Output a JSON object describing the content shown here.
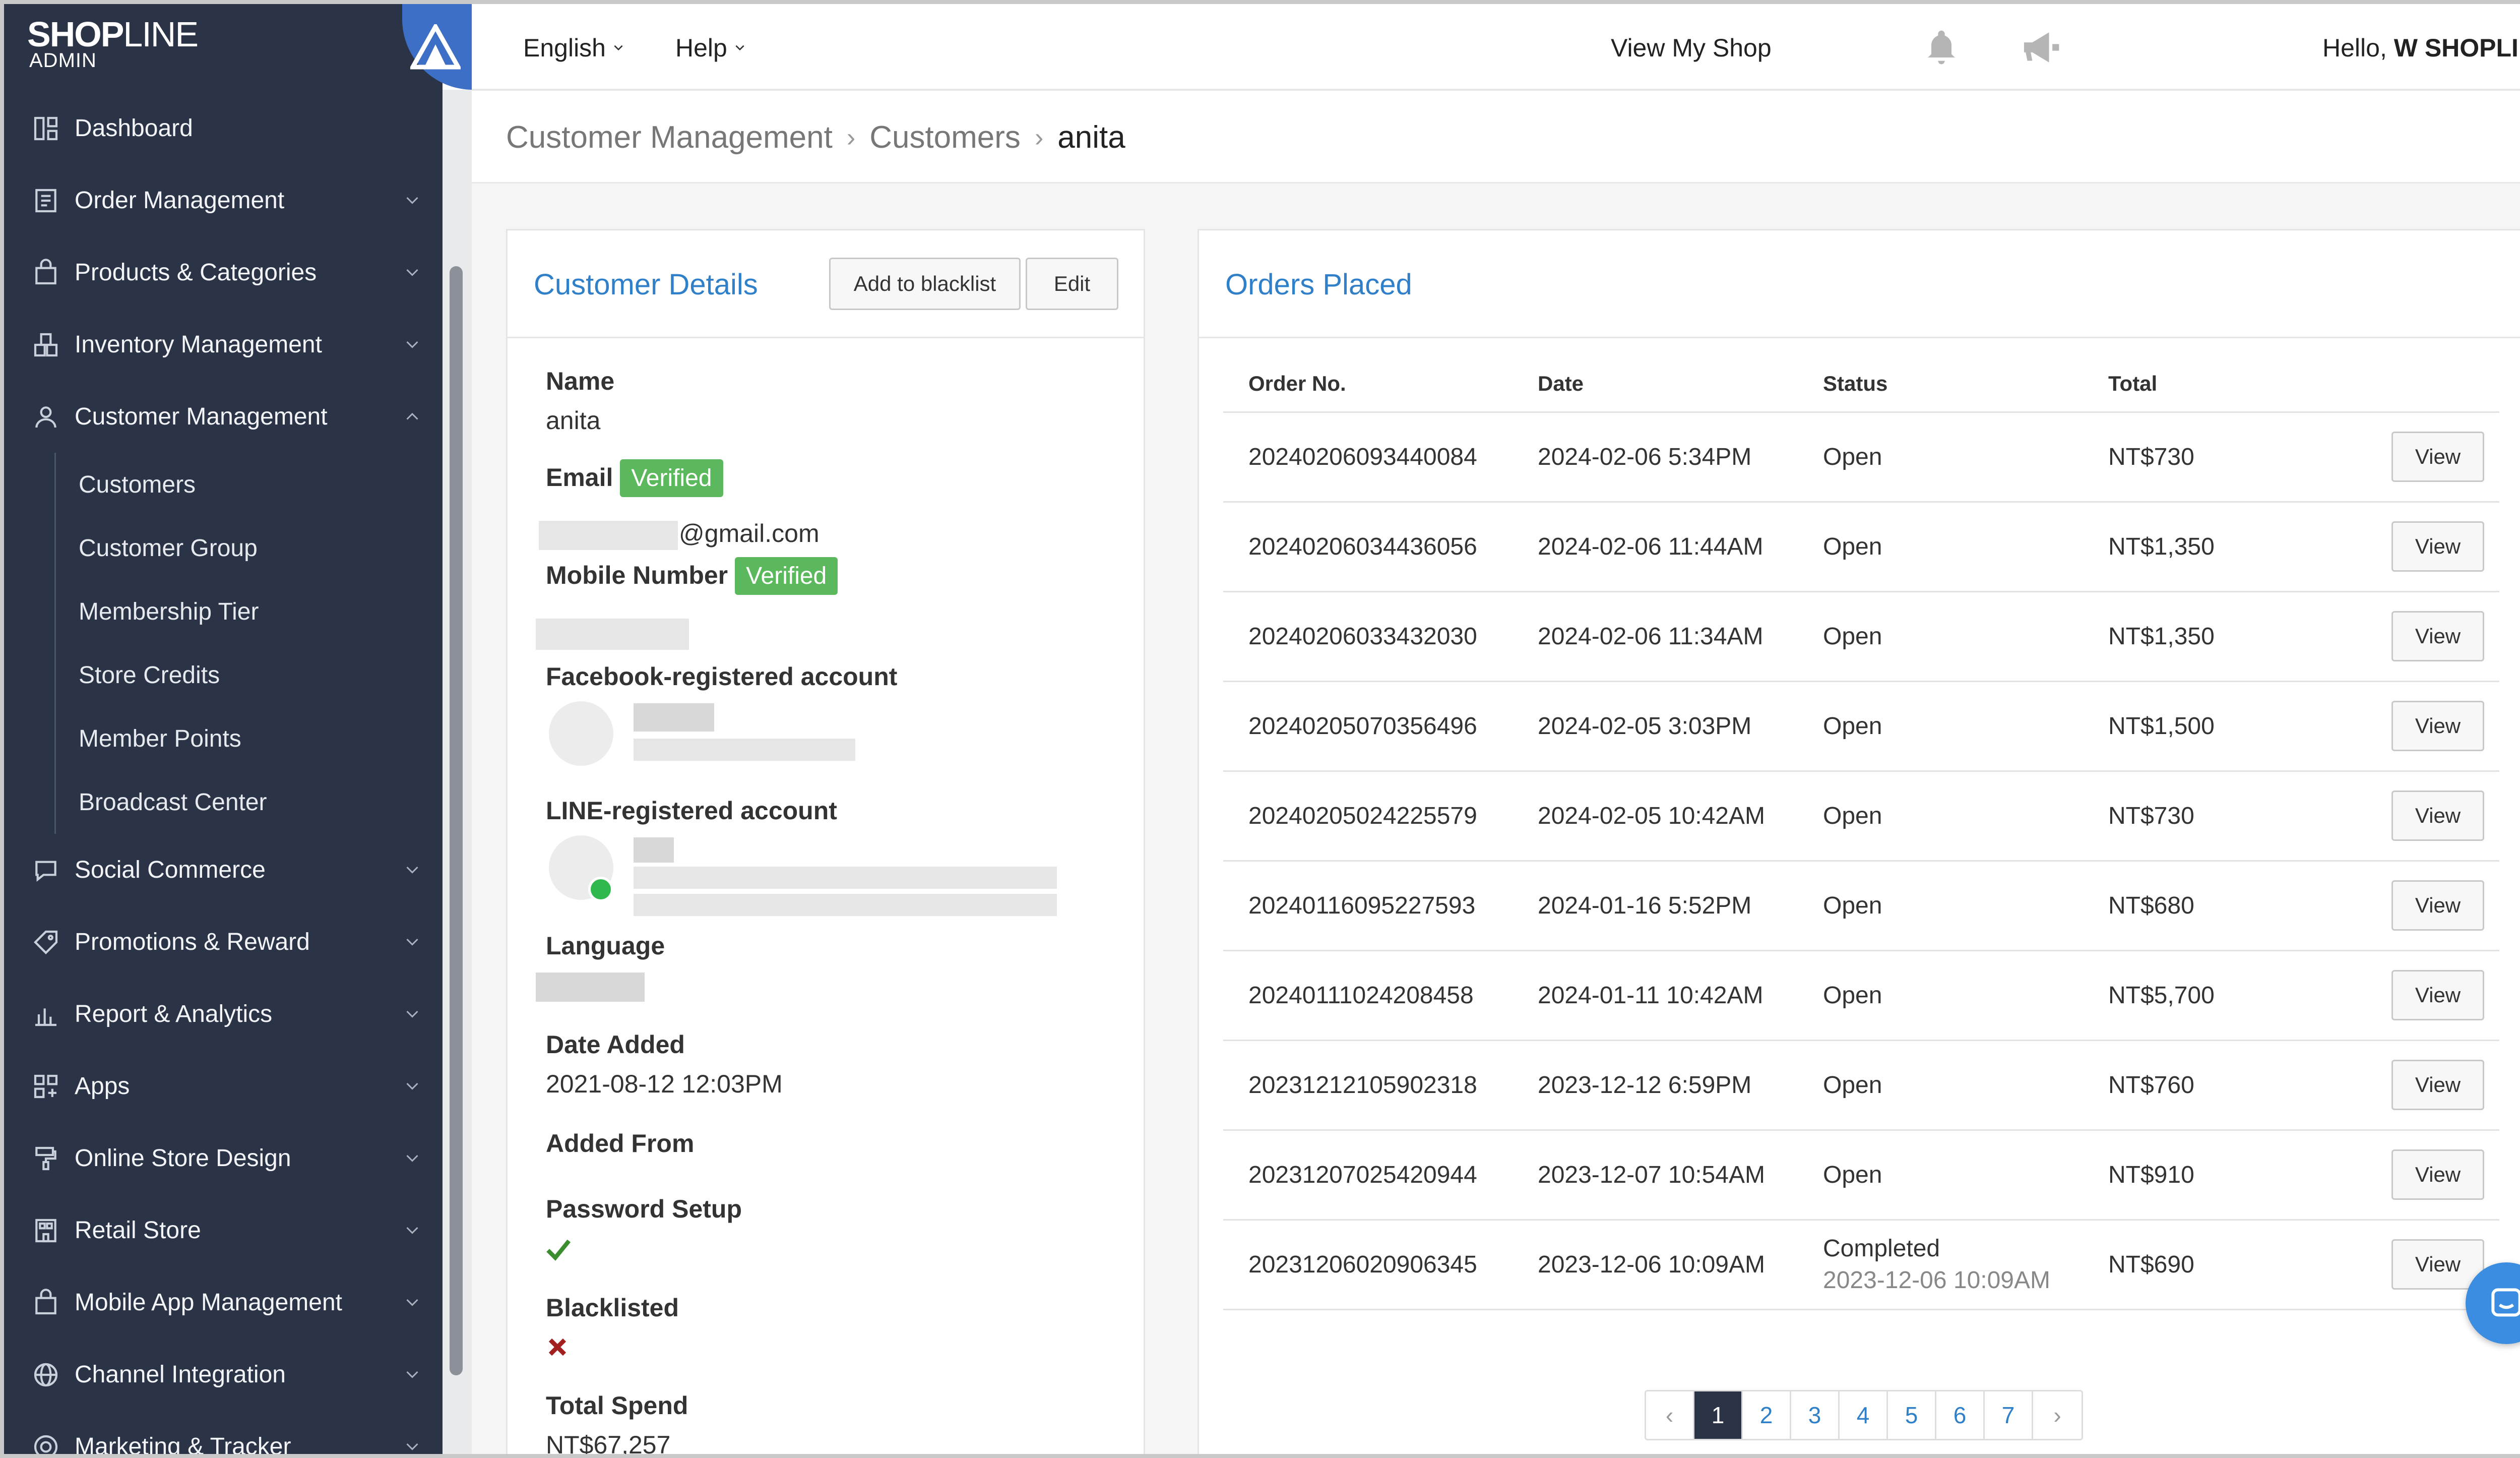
{
  "brand": {
    "logo_bold": "SHOP",
    "logo_thin": "LINE",
    "sub": "ADMIN"
  },
  "topbar": {
    "language": "English",
    "help": "Help",
    "view_shop": "View My Shop",
    "hello_prefix": "Hello, ",
    "hello_name": "W SHOPLINE"
  },
  "sidebar": {
    "items": [
      {
        "label": "Dashboard",
        "icon": "dashboard-icon",
        "chevron": false
      },
      {
        "label": "Order Management",
        "icon": "order-icon",
        "chevron": "down"
      },
      {
        "label": "Products & Categories",
        "icon": "bag-icon",
        "chevron": "down"
      },
      {
        "label": "Inventory Management",
        "icon": "inventory-icon",
        "chevron": "down"
      },
      {
        "label": "Customer Management",
        "icon": "user-icon",
        "chevron": "up"
      }
    ],
    "sub_items": [
      "Customers",
      "Customer Group",
      "Membership Tier",
      "Store Credits",
      "Member Points",
      "Broadcast Center"
    ],
    "items_after": [
      {
        "label": "Social Commerce",
        "icon": "chat-bubble-icon"
      },
      {
        "label": "Promotions & Reward",
        "icon": "tag-icon"
      },
      {
        "label": "Report & Analytics",
        "icon": "chart-icon"
      },
      {
        "label": "Apps",
        "icon": "apps-icon"
      },
      {
        "label": "Online Store Design",
        "icon": "paint-icon"
      },
      {
        "label": "Retail Store",
        "icon": "store-icon"
      },
      {
        "label": "Mobile App Management",
        "icon": "bag-icon"
      },
      {
        "label": "Channel Integration",
        "icon": "globe-icon"
      },
      {
        "label": "Marketing & Tracker",
        "icon": "target-icon"
      }
    ]
  },
  "breadcrumb": {
    "c1": "Customer Management",
    "c2": "Customers",
    "c3": "anita"
  },
  "details": {
    "title": "Customer Details",
    "blacklist_btn": "Add to blacklist",
    "edit_btn": "Edit",
    "name_label": "Name",
    "name_value": "anita",
    "email_label": "Email",
    "verified": "Verified",
    "email_value": "@gmail.com",
    "mobile_label": "Mobile Number",
    "fb_label": "Facebook-registered account",
    "line_label": "LINE-registered account",
    "language_label": "Language",
    "date_label": "Date Added",
    "date_value": "2021-08-12 12:03PM",
    "added_from_label": "Added From",
    "password_label": "Password Setup",
    "blacklisted_label": "Blacklisted",
    "spend_label": "Total Spend",
    "spend_value": "NT$67,257"
  },
  "orders": {
    "title": "Orders Placed",
    "headers": {
      "order_no": "Order No.",
      "date": "Date",
      "status": "Status",
      "total": "Total"
    },
    "view_label": "View",
    "rows": [
      {
        "no": "20240206093440084",
        "date": "2024-02-06 5:34PM",
        "status": "Open",
        "total": "NT$730"
      },
      {
        "no": "20240206034436056",
        "date": "2024-02-06 11:44AM",
        "status": "Open",
        "total": "NT$1,350"
      },
      {
        "no": "20240206033432030",
        "date": "2024-02-06 11:34AM",
        "status": "Open",
        "total": "NT$1,350"
      },
      {
        "no": "20240205070356496",
        "date": "2024-02-05 3:03PM",
        "status": "Open",
        "total": "NT$1,500"
      },
      {
        "no": "20240205024225579",
        "date": "2024-02-05 10:42AM",
        "status": "Open",
        "total": "NT$730"
      },
      {
        "no": "20240116095227593",
        "date": "2024-01-16 5:52PM",
        "status": "Open",
        "total": "NT$680"
      },
      {
        "no": "20240111024208458",
        "date": "2024-01-11 10:42AM",
        "status": "Open",
        "total": "NT$5,700"
      },
      {
        "no": "20231212105902318",
        "date": "2023-12-12 6:59PM",
        "status": "Open",
        "total": "NT$760"
      },
      {
        "no": "20231207025420944",
        "date": "2023-12-07 10:54AM",
        "status": "Open",
        "total": "NT$910"
      },
      {
        "no": "20231206020906345",
        "date": "2023-12-06 10:09AM",
        "status": "Completed",
        "status_sub": "2023-12-06 10:09AM",
        "total": "NT$690"
      }
    ],
    "pages": [
      "‹",
      "1",
      "2",
      "3",
      "4",
      "5",
      "6",
      "7",
      "›"
    ]
  }
}
